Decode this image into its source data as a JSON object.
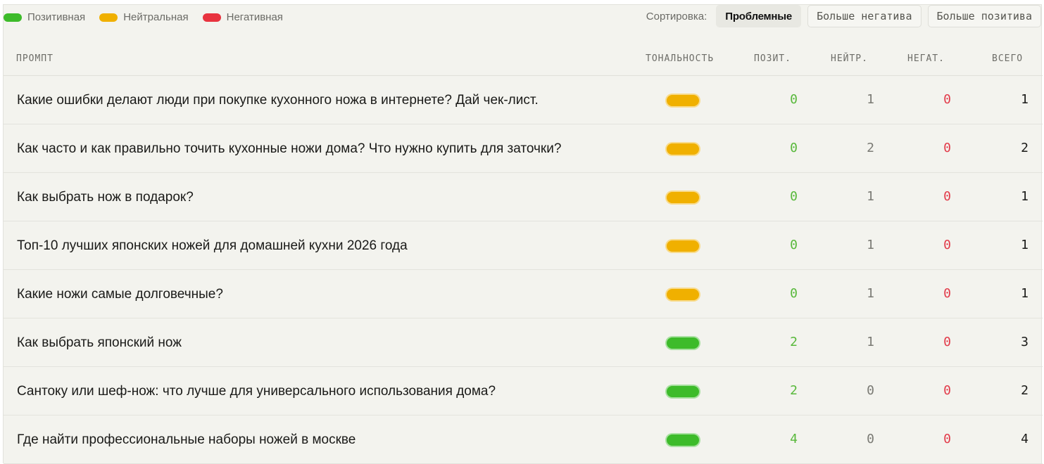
{
  "legend": [
    {
      "label": "Позитивная",
      "color": "#3dbb2a"
    },
    {
      "label": "Нейтральная",
      "color": "#f0b000"
    },
    {
      "label": "Негативная",
      "color": "#e8333f"
    }
  ],
  "sort": {
    "label": "Сортировка:",
    "options": [
      "Проблемные",
      "Больше негатива",
      "Больше позитива"
    ],
    "active": "Проблемные"
  },
  "table": {
    "columns": {
      "prompt": "ПРОМПТ",
      "tone": "ТОНАЛЬНОСТЬ",
      "pos": "ПОЗИТ.",
      "neu": "НЕЙТР.",
      "neg": "НЕГАТ.",
      "total": "ВСЕГО"
    },
    "rows": [
      {
        "prompt": "Какие ошибки делают люди при покупке кухонного ножа в интернете? Дай чек-лист.",
        "tone": "neutral",
        "tone_color": "#f0b000",
        "pos": "0",
        "neu": "1",
        "neg": "0",
        "total": "1"
      },
      {
        "prompt": "Как часто и как правильно точить кухонные ножи дома? Что нужно купить для заточки?",
        "tone": "neutral",
        "tone_color": "#f0b000",
        "pos": "0",
        "neu": "2",
        "neg": "0",
        "total": "2"
      },
      {
        "prompt": "Как выбрать нож в подарок?",
        "tone": "neutral",
        "tone_color": "#f0b000",
        "pos": "0",
        "neu": "1",
        "neg": "0",
        "total": "1"
      },
      {
        "prompt": "Топ-10 лучших японских ножей для домашней кухни 2026 года",
        "tone": "neutral",
        "tone_color": "#f0b000",
        "pos": "0",
        "neu": "1",
        "neg": "0",
        "total": "1"
      },
      {
        "prompt": "Какие ножи самые долговечные?",
        "tone": "neutral",
        "tone_color": "#f0b000",
        "pos": "0",
        "neu": "1",
        "neg": "0",
        "total": "1"
      },
      {
        "prompt": "Как выбрать японский нож",
        "tone": "positive",
        "tone_color": "#3dbb2a",
        "pos": "2",
        "neu": "1",
        "neg": "0",
        "total": "3"
      },
      {
        "prompt": "Сантоку или шеф-нож: что лучше для универсального использования дома?",
        "tone": "positive",
        "tone_color": "#3dbb2a",
        "pos": "2",
        "neu": "0",
        "neg": "0",
        "total": "2"
      },
      {
        "prompt": "Где найти профессиональные наборы ножей в москве",
        "tone": "positive",
        "tone_color": "#3dbb2a",
        "pos": "4",
        "neu": "0",
        "neg": "0",
        "total": "4"
      }
    ]
  }
}
